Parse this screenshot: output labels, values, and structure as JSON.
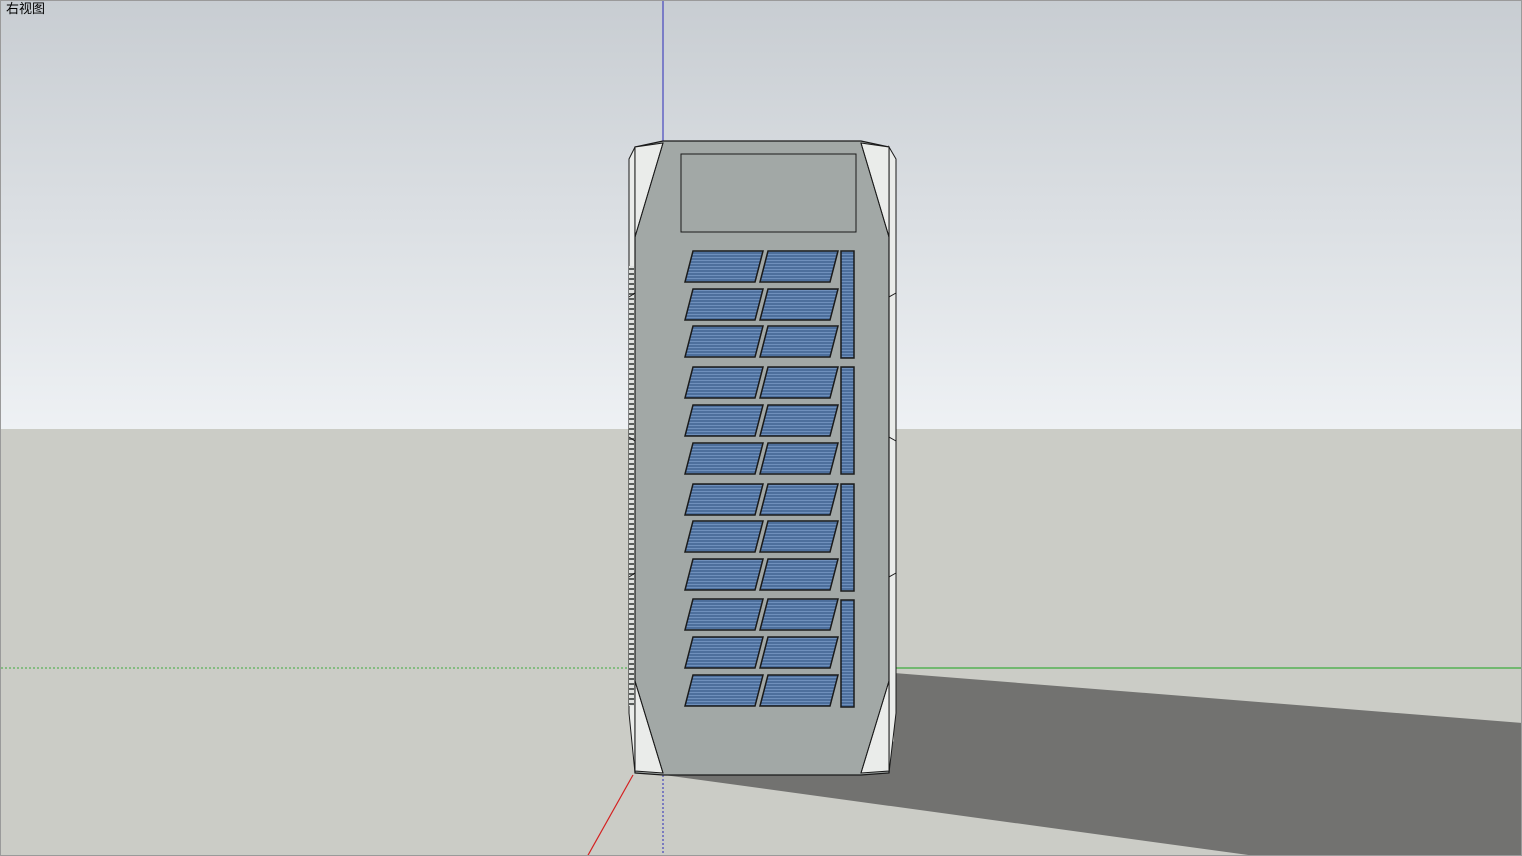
{
  "viewport": {
    "view_name": "右视图",
    "colors": {
      "sky_top": "#c8cdd2",
      "sky_bottom": "#eef1f4",
      "ground": "#cbccc6",
      "shadow": "#727270",
      "body": "#a2a8a6",
      "body_dark": "#8f9593",
      "bevel_light": "#eaecea",
      "edge": "#1a1a1a",
      "panel_face": "#4d6f9c",
      "panel_stripe": "#6f90bc",
      "axis_red": "#d42020",
      "axis_green": "#3cab3c",
      "axis_blue": "#2a2ab8"
    }
  }
}
